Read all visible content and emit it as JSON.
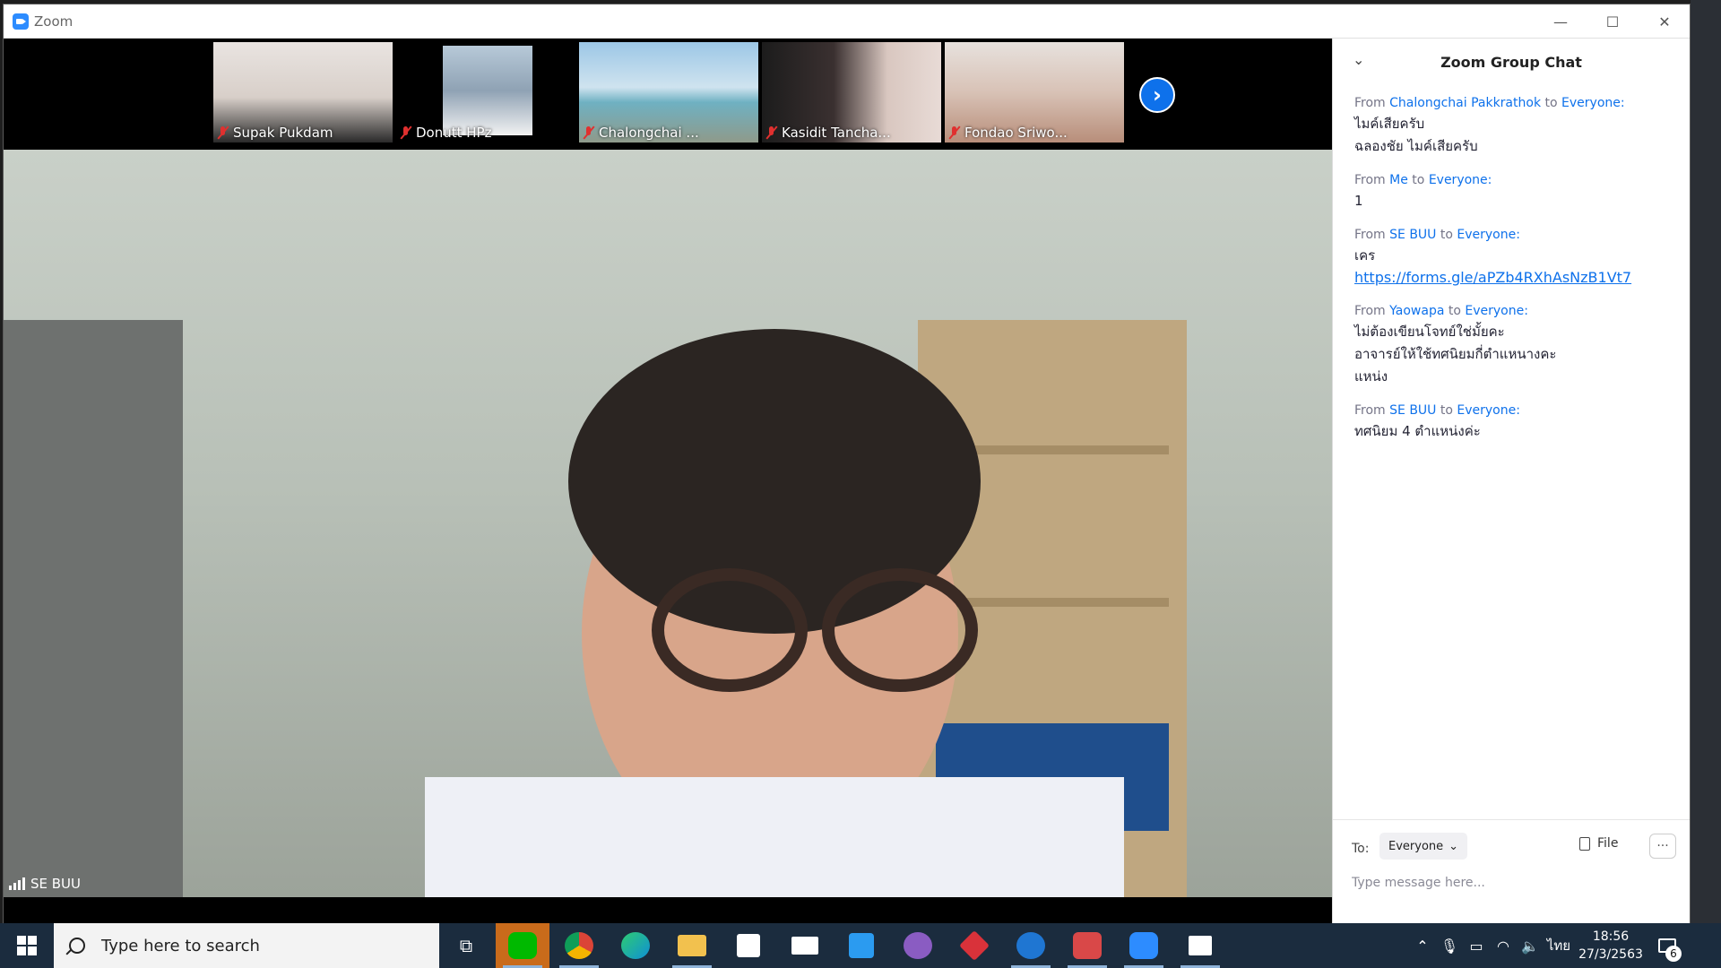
{
  "window": {
    "title": "Zoom",
    "controls": {
      "minimize": "—",
      "maximize": "☐",
      "close": "✕"
    }
  },
  "participants": [
    {
      "name": "Supak Pukdam",
      "muted": true
    },
    {
      "name": "Donutt HPz",
      "muted": true
    },
    {
      "name": "Chalongchai ...",
      "muted": true
    },
    {
      "name": "Kasidit Tancha...",
      "muted": true
    },
    {
      "name": "Fondao Sriwo...",
      "muted": true
    }
  ],
  "next_arrow": "›",
  "main_video": {
    "name": "SE BUU"
  },
  "chat": {
    "title": "Zoom Group Chat",
    "collapse_icon": "⌄",
    "messages": [
      {
        "from_label": "From",
        "sender": "Chalongchai Pakkrathok",
        "to_label": "to",
        "recipient": "Everyone:",
        "lines": [
          "ไมค์เสียครับ",
          "ฉลองชัย ไมค์เสียครับ"
        ]
      },
      {
        "from_label": "From",
        "sender": "Me",
        "to_label": "to",
        "recipient": "Everyone:",
        "lines": [
          "1"
        ]
      },
      {
        "from_label": "From",
        "sender": "SE BUU",
        "to_label": "to",
        "recipient": "Everyone:",
        "lines": [
          "เคร"
        ],
        "link": "https://forms.gle/aPZb4RXhAsNzB1Vt7"
      },
      {
        "from_label": "From",
        "sender": "Yaowapa",
        "to_label": "to",
        "recipient": "Everyone:",
        "lines": [
          "ไม่ต้องเขียนโจทย์ใช่มั้ยคะ",
          "อาจารย์ให้ใช้ทศนิยมกี่ตำแหนางคะ",
          "แหน่ง"
        ]
      },
      {
        "from_label": "From",
        "sender": "SE BUU",
        "to_label": "to",
        "recipient": "Everyone:",
        "lines": [
          "ทศนิยม 4 ตำแหน่งค่ะ"
        ]
      }
    ],
    "to_label": "To:",
    "to_value": "Everyone",
    "file_label": "File",
    "more_label": "···",
    "input_placeholder": "Type message here..."
  },
  "taskbar": {
    "search_placeholder": "Type here to search",
    "apps": [
      {
        "name": "task-view",
        "label": ""
      },
      {
        "name": "line",
        "label": "LINE",
        "color": "#00b900"
      },
      {
        "name": "chrome",
        "label": "",
        "color": "#db4437"
      },
      {
        "name": "edge",
        "label": "",
        "color": "#0f8fd6"
      },
      {
        "name": "file-explorer",
        "label": "",
        "color": "#f2c14e"
      },
      {
        "name": "store",
        "label": "",
        "color": "#3a6fc4"
      },
      {
        "name": "mail",
        "label": "",
        "color": "#ffffff"
      },
      {
        "name": "vscode",
        "label": "",
        "color": "#2b9bf0"
      },
      {
        "name": "github-desktop",
        "label": "",
        "color": "#8a5cc2"
      },
      {
        "name": "git-kraken",
        "label": "",
        "color": "#d9323a"
      },
      {
        "name": "teamviewer",
        "label": "",
        "color": "#1f76d2"
      },
      {
        "name": "recorder",
        "label": "",
        "color": "#d94848"
      },
      {
        "name": "zoom",
        "label": "",
        "color": "#2d8cff"
      },
      {
        "name": "photos",
        "label": "",
        "color": "#ffffff"
      }
    ],
    "tray": {
      "language": "ไทย",
      "time": "18:56",
      "date": "27/3/2563",
      "notification_count": "6"
    }
  }
}
